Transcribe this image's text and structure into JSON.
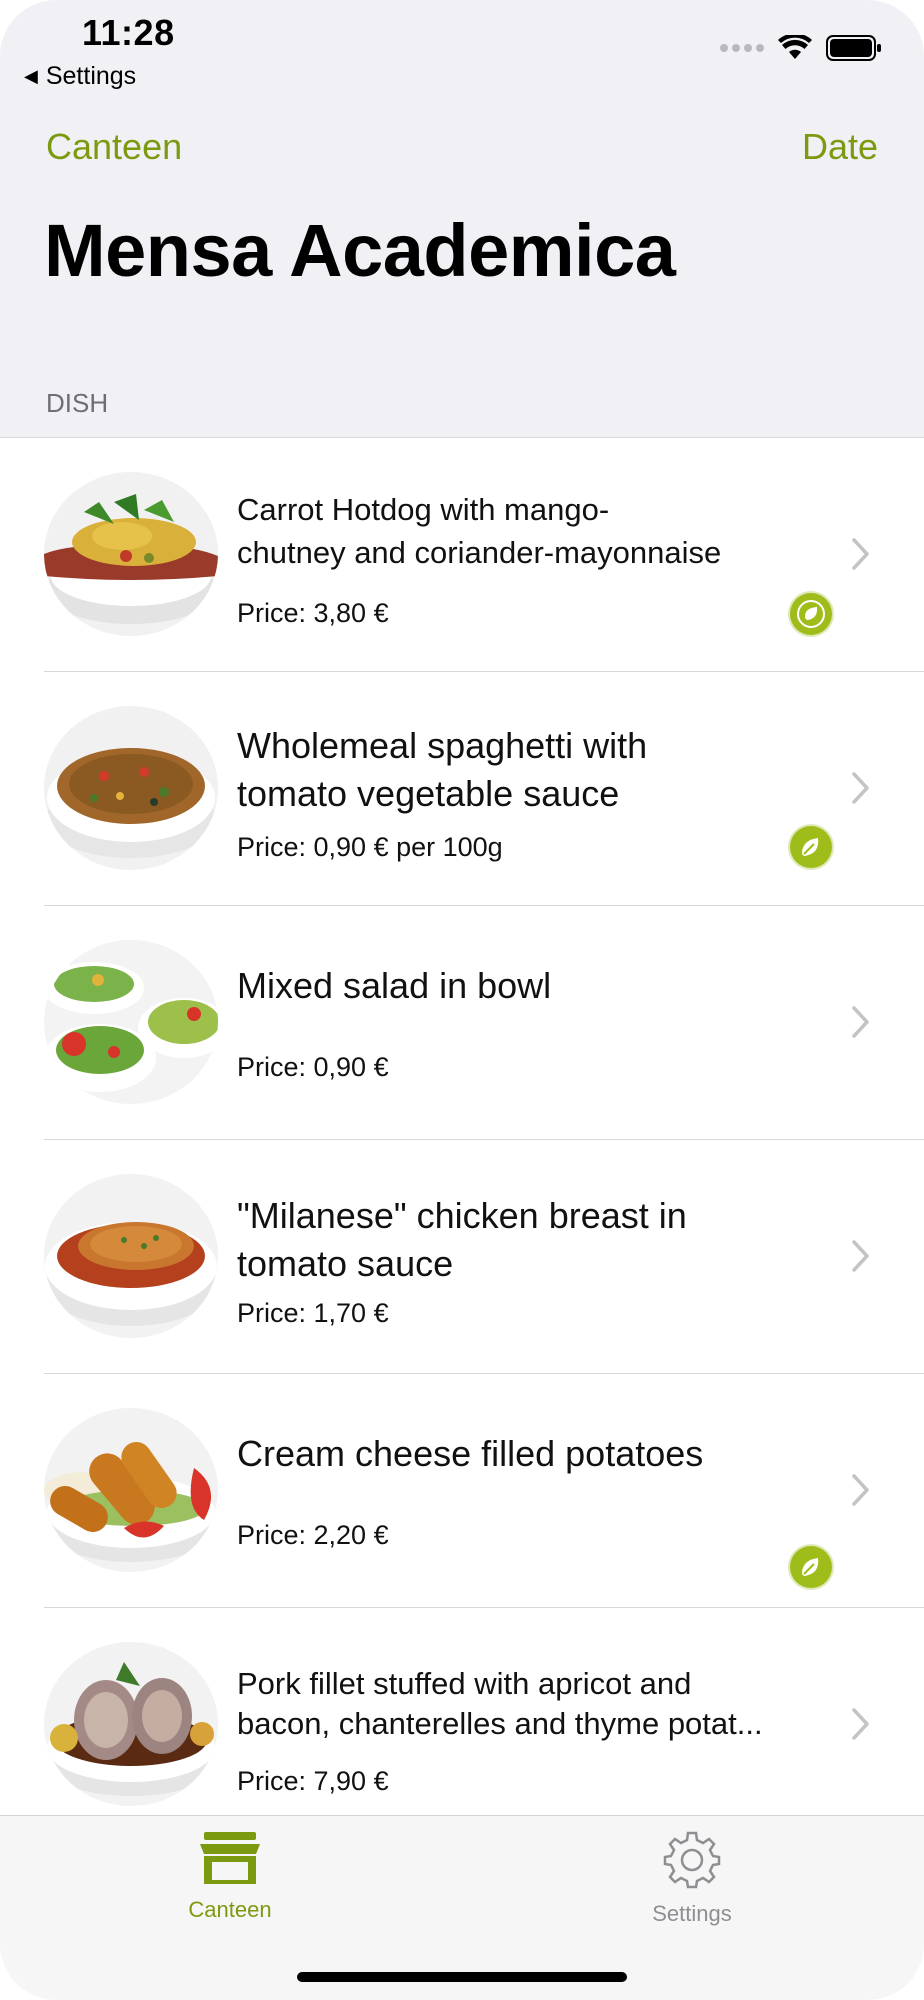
{
  "status_bar": {
    "time": "11:28",
    "back_app": "Settings"
  },
  "nav": {
    "left_label": "Canteen",
    "right_label": "Date",
    "title": "Mensa Academica"
  },
  "section": {
    "header": "DISH"
  },
  "dishes": [
    {
      "name_line1": "Carrot Hotdog with mango-",
      "name_line2": "chutney and coriander-mayonnaise",
      "price": "Price: 3,80 €",
      "badge": "vegan-leaf-icon"
    },
    {
      "name_line1": "Wholemeal spaghetti with",
      "name_line2": "tomato vegetable sauce",
      "price": "Price: 0,90 € per 100g",
      "badge": "vegetarian-leaf-icon"
    },
    {
      "name_line1": "Mixed salad in bowl",
      "name_line2": "",
      "price": "Price: 0,90 €",
      "badge": ""
    },
    {
      "name_line1": "\"Milanese\" chicken breast in",
      "name_line2": "tomato sauce",
      "price": "Price: 1,70 €",
      "badge": ""
    },
    {
      "name_line1": "Cream cheese filled potatoes",
      "name_line2": "",
      "price": "Price: 2,20 €",
      "badge": "vegetarian-leaf-icon"
    },
    {
      "name_line1": "Pork fillet stuffed with apricot and",
      "name_line2": "bacon, chanterelles and thyme potat...",
      "price": "Price: 7,90 €",
      "badge": ""
    }
  ],
  "tabbar": {
    "tabs": [
      {
        "label": "Canteen",
        "icon": "canteen-store-icon",
        "selected": true
      },
      {
        "label": "Settings",
        "icon": "gear-icon",
        "selected": false
      }
    ]
  },
  "colors": {
    "accent": "#7c9a10",
    "badge": "#9fbd1a",
    "header_background": "#f1f1f5",
    "inactive_tab": "#8e8e93"
  }
}
